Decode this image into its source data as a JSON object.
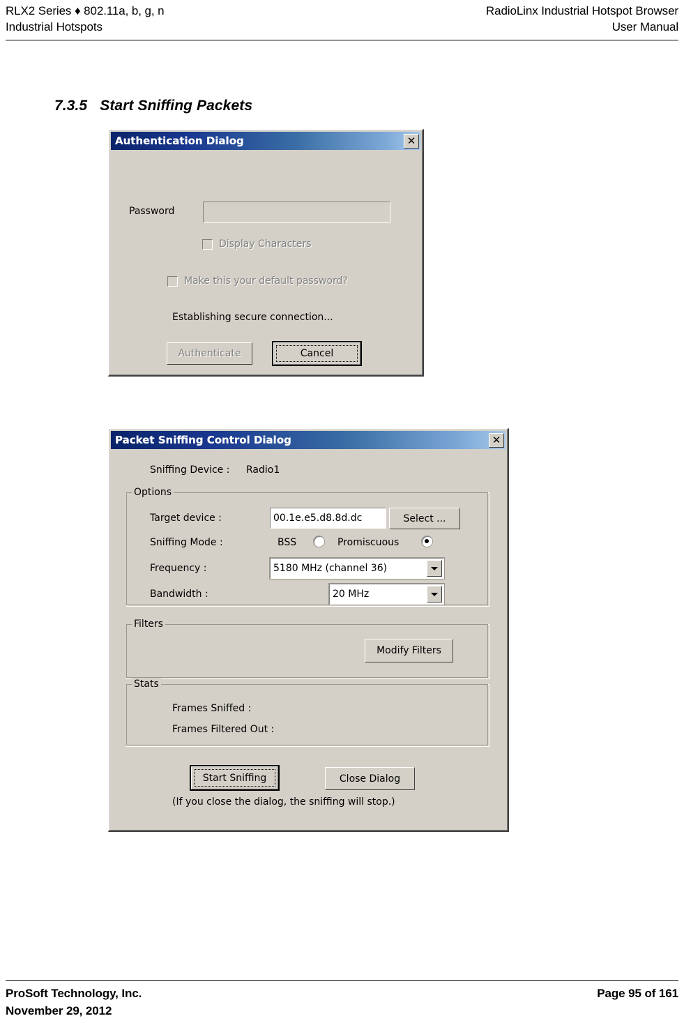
{
  "header": {
    "left_line1": "RLX2 Series ♦ 802.11a, b, g, n",
    "left_line2": "Industrial Hotspots",
    "right_line1": "RadioLinx Industrial Hotspot Browser",
    "right_line2": "User Manual"
  },
  "section": {
    "number": "7.3.5",
    "title": "Start Sniffing Packets"
  },
  "auth_dialog": {
    "title": "Authentication Dialog",
    "close_icon": "close-x-icon",
    "password_label": "Password",
    "password_value": "",
    "display_characters_label": "Display Characters",
    "default_password_label": "Make this your default password?",
    "status_text": "Establishing secure connection...",
    "authenticate_button": "Authenticate",
    "cancel_button": "Cancel"
  },
  "sniff_dialog": {
    "title": "Packet Sniffing Control Dialog",
    "close_icon": "close-x-icon",
    "sniffing_device_label": "Sniffing Device :",
    "sniffing_device_value": "Radio1",
    "options_group": "Options",
    "target_device_label": "Target device :",
    "target_device_value": "00.1e.e5.d8.8d.dc",
    "select_button": "Select ...",
    "sniffing_mode_label": "Sniffing Mode :",
    "mode_bss_label": "BSS",
    "mode_promiscuous_label": "Promiscuous",
    "frequency_label": "Frequency :",
    "frequency_value": "5180 MHz (channel 36)",
    "bandwidth_label": "Bandwidth :",
    "bandwidth_value": "20 MHz",
    "filters_group": "Filters",
    "modify_filters_button": "Modify Filters",
    "stats_group": "Stats",
    "frames_sniffed_label": "Frames Sniffed :",
    "frames_sniffed_value": "",
    "frames_filtered_label": "Frames Filtered Out :",
    "frames_filtered_value": "",
    "start_sniffing_button": "Start Sniffing",
    "close_dialog_button": "Close Dialog",
    "note_text": "(If you close the dialog, the sniffing will stop.)"
  },
  "footer": {
    "left_line1": "ProSoft Technology, Inc.",
    "left_line2": "November 29, 2012",
    "right_line1": "Page 95 of 161"
  },
  "colors": {
    "dialog_face": "#d4d0c8",
    "titlebar_start": "#0a246a",
    "titlebar_end": "#a6c8ea",
    "disabled_text": "#808080"
  }
}
